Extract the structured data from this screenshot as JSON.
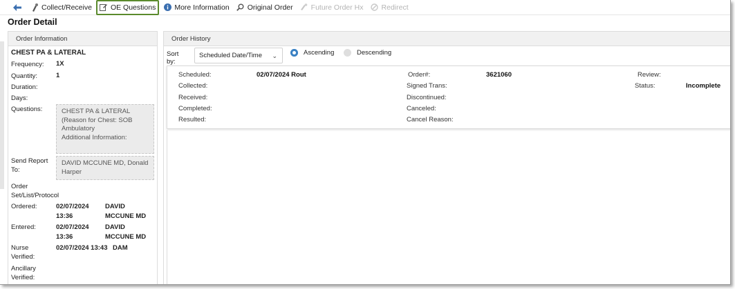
{
  "toolbar": {
    "items": [
      {
        "label": "Collect/Receive",
        "icon": "collect-icon",
        "enabled": true
      },
      {
        "label": "OE Questions",
        "icon": "edit-icon",
        "enabled": true,
        "highlighted": true
      },
      {
        "label": "More Information",
        "icon": "info-icon",
        "enabled": true
      },
      {
        "label": "Original Order",
        "icon": "search-icon",
        "enabled": true
      },
      {
        "label": "Future Order Hx",
        "icon": "future-order-icon",
        "enabled": false
      },
      {
        "label": "Redirect",
        "icon": "redirect-icon",
        "enabled": false
      }
    ],
    "highlight_color": "#5a8a2c"
  },
  "page": {
    "title": "Order Detail"
  },
  "order_info": {
    "header": "Order Information",
    "order_name": "CHEST PA & LATERAL",
    "frequency_label": "Frequency:",
    "frequency": "1X",
    "quantity_label": "Quantity:",
    "quantity": "1",
    "duration_label": "Duration:",
    "days_label": "Days:",
    "questions_label": "Questions:",
    "questions_lines": [
      "CHEST PA & LATERAL",
      "(Reason for Chest: SOB",
      "Ambulatory",
      "Additional Information:"
    ],
    "send_report_label": "Send Report To:",
    "send_report_to": "DAVID MCCUNE MD, Donald Harper",
    "order_set_label": "Order Set/List/Protocol",
    "ordered_label": "Ordered:",
    "ordered_date": "02/07/2024 13:36",
    "ordered_by": "DAVID MCCUNE MD",
    "entered_label": "Entered:",
    "entered_date": "02/07/2024 13:36",
    "entered_by": "DAVID MCCUNE MD",
    "nurse_verified_label": "Nurse Verified:",
    "nurse_verified_date": "02/07/2024 13:43",
    "nurse_verified_by": "DAM",
    "ancillary_verified_label": "Ancillary Verified:"
  },
  "order_history": {
    "header": "Order History",
    "sort_label": "Sort by:",
    "sort_value": "Scheduled Date/Time",
    "ascending_label": "Ascending",
    "descending_label": "Descending",
    "selected_order": "ascending",
    "record": {
      "scheduled_label": "Scheduled:",
      "scheduled": "02/07/2024 Rout",
      "collected_label": "Collected:",
      "received_label": "Received:",
      "completed_label": "Completed:",
      "resulted_label": "Resulted:",
      "order_num_label": "Order#:",
      "order_num": "3621060",
      "signed_trans_label": "Signed Trans:",
      "discontinued_label": "Discontinued:",
      "canceled_label": "Canceled:",
      "cancel_reason_label": "Cancel Reason:",
      "review_label": "Review:",
      "status_label": "Status:",
      "status": "Incomplete"
    }
  },
  "colors": {
    "accent": "#3b82c4",
    "panel_header": "#f1f1f1"
  }
}
